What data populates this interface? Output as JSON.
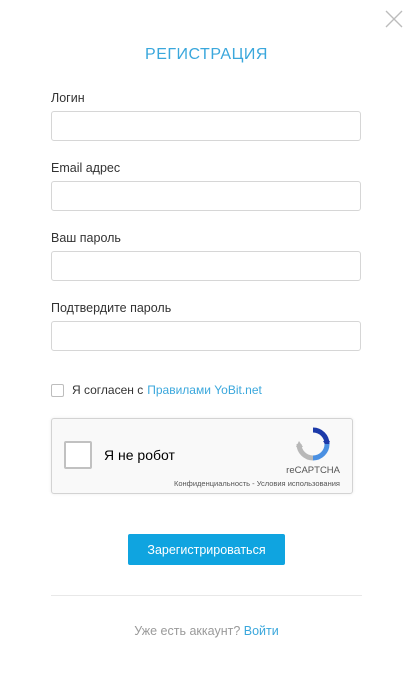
{
  "modal": {
    "title": "РЕГИСТРАЦИЯ"
  },
  "form": {
    "login_label": "Логин",
    "login_value": "",
    "email_label": "Email адрес",
    "email_value": "",
    "password_label": "Ваш пароль",
    "password_value": "",
    "confirm_label": "Подтвердите пароль",
    "confirm_value": ""
  },
  "agree": {
    "text": "Я согласен с",
    "link": "Правилами YoBit.net",
    "checked": false
  },
  "recaptcha": {
    "label": "Я не робот",
    "brand": "reCAPTCHA",
    "links": "Конфиденциальность - Условия использования"
  },
  "submit": {
    "label": "Зарегистрироваться"
  },
  "footer": {
    "text": "Уже есть аккаунт?",
    "link": "Войти"
  },
  "colors": {
    "accent": "#3aa7dc",
    "button": "#0fa4e0"
  },
  "icons": {
    "close": "close-icon",
    "recaptcha": "recaptcha-logo-icon"
  }
}
